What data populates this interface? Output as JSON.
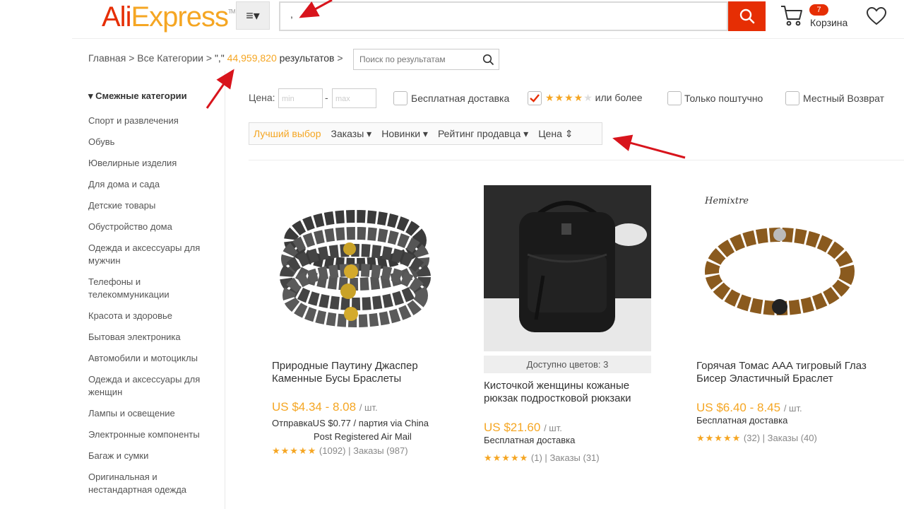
{
  "header": {
    "logo_left": "Ali",
    "logo_right": "Express",
    "logo_tm": "TM",
    "search_value": ",",
    "cart_label": "Корзина",
    "cart_count": "7"
  },
  "breadcrumb": {
    "home": "Главная",
    "sep": ">",
    "all_categories": "Все Категории",
    "query": "\",\"",
    "results_count": "44,959,820",
    "results_label": "результатов",
    "refine_placeholder": "Поиск по результатам"
  },
  "sidebar": {
    "title": "▾ Смежные категории",
    "items": [
      "Спорт и развлечения",
      "Обувь",
      "Ювелирные изделия",
      "Для дома и сада",
      "Детские товары",
      "Обустройство дома",
      "Одежда и аксессуары для мужчин",
      "Телефоны и телекоммуникации",
      "Красота и здоровье",
      "Бытовая электроника",
      "Автомобили и мотоциклы",
      "Одежда и аксессуары для женщин",
      "Лампы и освещение",
      "Электронные компоненты",
      "Багаж и сумки",
      "Оригинальная и нестандартная одежда"
    ]
  },
  "filters": {
    "price_label": "Цена:",
    "min_placeholder": "min",
    "max_placeholder": "max",
    "dash": "-",
    "free_shipping": "Бесплатная доставка",
    "rating_stars": "★★★★",
    "rating_star_off": "★",
    "rating_suffix": "или более",
    "only_single": "Только поштучно",
    "local_return": "Местный Возврат"
  },
  "sort": {
    "best": "Лучший выбор",
    "orders": "Заказы ▾",
    "newest": "Новинки ▾",
    "seller_rating": "Рейтинг продавца ▾",
    "price": "Цена ⇕"
  },
  "products": [
    {
      "title": "Природные Паутину Джаспер Каменные Бусы Браслеты",
      "price": "US $4.34 - 8.08",
      "unit": "/ шт.",
      "ship_line1": "ОтправкаUS $0.77 / партия via China",
      "ship_line2": "Post Registered Air Mail",
      "stars": "★★★★★",
      "reviews": "(1092)",
      "divider": "|",
      "orders": "Заказы (987)"
    },
    {
      "colors": "Доступно цветов: 3",
      "title": "Кисточкой женщины кожаные рюкзак подростковой рюкзаки",
      "price": "US $21.60",
      "unit": "/ шт.",
      "shipping": "Бесплатная доставка",
      "stars": "★★★★★",
      "reviews": "(1)",
      "divider": "|",
      "orders": "Заказы (31)"
    },
    {
      "image_text": "Hemixtre",
      "title": "Горячая Томас ААА тигровый Глаз Бисер Эластичный Браслет",
      "price": "US $6.40 - 8.45",
      "unit": "/ шт.",
      "shipping": "Бесплатная доставка",
      "stars": "★★★★★",
      "reviews": "(32)",
      "divider": "|",
      "orders": "Заказы (40)"
    }
  ],
  "colors": {
    "brand_red": "#e62e04",
    "brand_orange": "#f5a623",
    "annotation_arrow": "#d8141c"
  }
}
